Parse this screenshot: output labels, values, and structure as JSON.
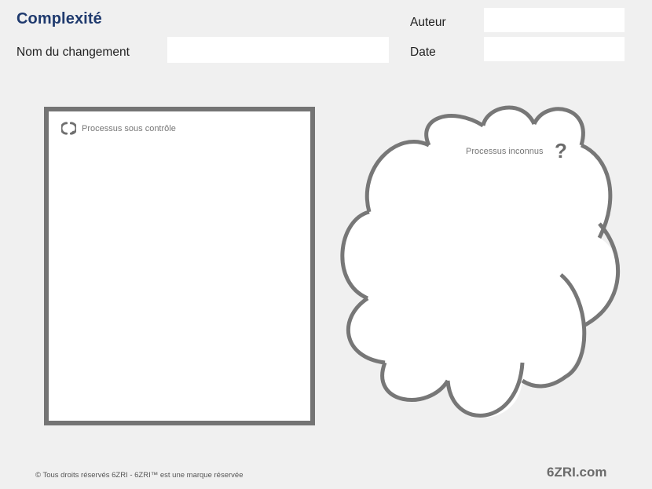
{
  "header": {
    "title": "Complexité",
    "change_name_label": "Nom du changement",
    "change_name_value": "",
    "author_label": "Auteur",
    "author_value": "",
    "date_label": "Date",
    "date_value": ""
  },
  "controlled_box": {
    "label": "Processus sous contrôle",
    "icon": "cycle-icon"
  },
  "unknown_cloud": {
    "label": "Processus inconnus",
    "icon": "question-icon",
    "icon_glyph": "?"
  },
  "footer": {
    "copyright": "© Tous droits réservés 6ZRI - 6ZRI™ est une marque réservée",
    "brand": "6ZRI.com"
  },
  "colors": {
    "title": "#1f3a6e",
    "frame": "#747474",
    "background": "#f0f0f0",
    "field": "#ffffff"
  }
}
